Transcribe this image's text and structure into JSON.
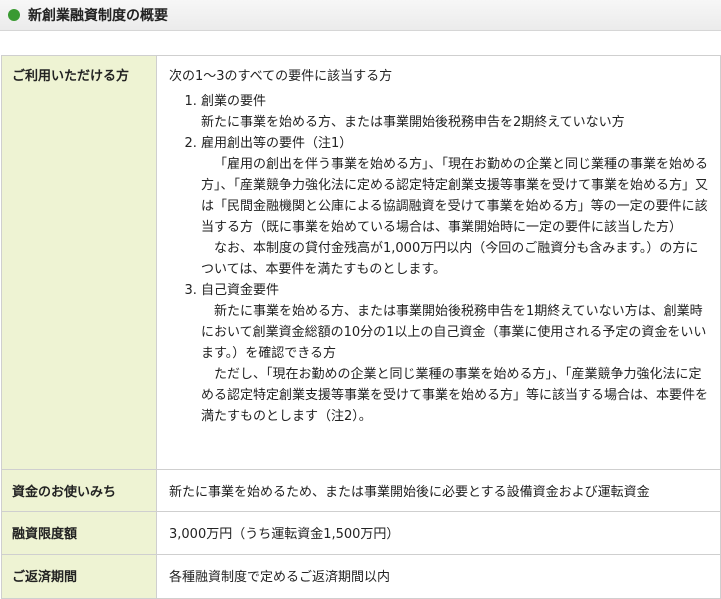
{
  "heading": {
    "title": "新創業融資制度の概要"
  },
  "table": {
    "eligibility": {
      "label": "ご利用いただける方",
      "intro": "次の1〜3のすべての要件に該当する方",
      "requirements": [
        {
          "title": "創業の要件",
          "body": "新たに事業を始める方、または事業開始後税務申告を2期終えていない方"
        },
        {
          "title": "雇用創出等の要件（注1）",
          "body": "「雇用の創出を伴う事業を始める方」、「現在お勤めの企業と同じ業種の事業を始める方」、「産業競争力強化法に定める認定特定創業支援等事業を受けて事業を始める方」又は「民間金融機関と公庫による協調融資を受けて事業を始める方」等の一定の要件に該当する方（既に事業を始めている場合は、事業開始時に一定の要件に該当した方）",
          "note": "なお、本制度の貸付金残高が1,000万円以内（今回のご融資分も含みます。）の方については、本要件を満たすものとします。"
        },
        {
          "title": "自己資金要件",
          "body": "新たに事業を始める方、または事業開始後税務申告を1期終えていない方は、創業時において創業資金総額の10分の1以上の自己資金（事業に使用される予定の資金をいいます。）を確認できる方",
          "note": "ただし、「現在お勤めの企業と同じ業種の事業を始める方」、「産業競争力強化法に定める認定特定創業支援等事業を受けて事業を始める方」等に該当する場合は、本要件を満たすものとします（注2）。"
        }
      ]
    },
    "use_of_funds": {
      "label": "資金のお使いみち",
      "value": "新たに事業を始めるため、または事業開始後に必要とする設備資金および運転資金"
    },
    "loan_limit": {
      "label": "融資限度額",
      "value": "3,000万円（うち運転資金1,500万円）"
    },
    "repayment_period": {
      "label": "ご返済期間",
      "value": "各種融資制度で定めるご返済期間以内"
    }
  },
  "colors": {
    "accent_dot": "#3a9a32",
    "label_background": "#eef3d3",
    "border": "#cfcfcf"
  }
}
